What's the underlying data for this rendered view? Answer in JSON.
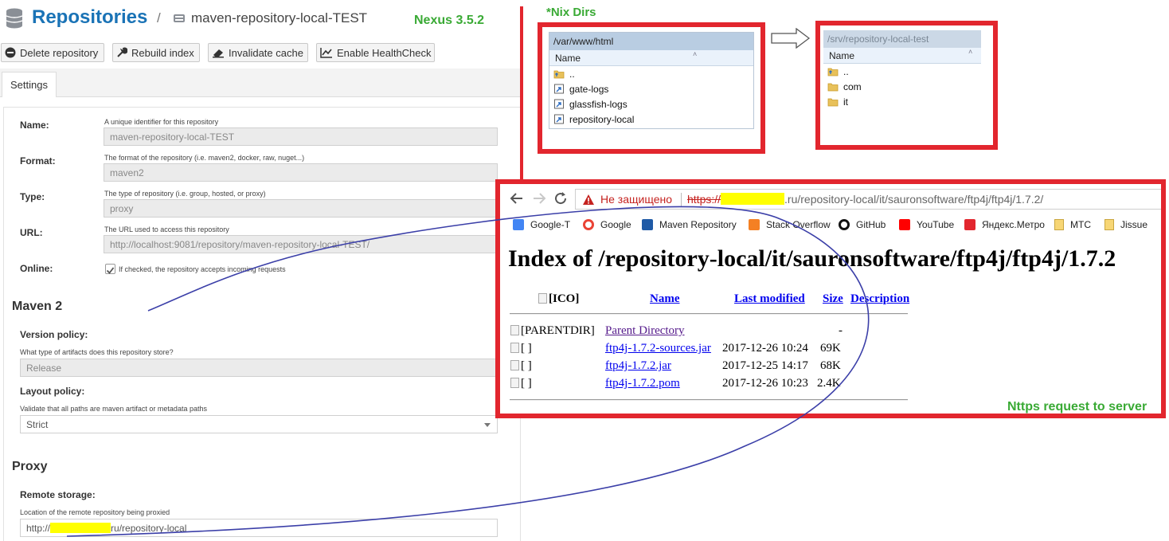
{
  "nexus": {
    "title": "Repositories",
    "separator": "/",
    "repo_name": "maven-repository-local-TEST",
    "version_label": "Nexus 3.5.2",
    "toolbar": [
      {
        "label": "Delete repository",
        "icon": "delete-icon"
      },
      {
        "label": "Rebuild index",
        "icon": "wrench-icon"
      },
      {
        "label": "Invalidate cache",
        "icon": "eraser-icon"
      },
      {
        "label": "Enable HealthCheck",
        "icon": "chart-icon"
      }
    ],
    "tab": "Settings",
    "fields": {
      "name": {
        "label": "Name:",
        "help": "A unique identifier for this repository",
        "value": "maven-repository-local-TEST"
      },
      "format": {
        "label": "Format:",
        "help": "The format of the repository (i.e. maven2, docker, raw, nuget...)",
        "value": "maven2"
      },
      "type": {
        "label": "Type:",
        "help": "The type of repository (i.e. group, hosted, or proxy)",
        "value": "proxy"
      },
      "url": {
        "label": "URL:",
        "help": "The URL used to access this repository",
        "value": "http://localhost:9081/repository/maven-repository-local-TEST/"
      },
      "online": {
        "label": "Online:",
        "help": "If checked, the repository accepts incoming requests",
        "checked": true
      }
    },
    "maven2": {
      "heading": "Maven 2",
      "version_policy": {
        "label": "Version policy:",
        "help": "What type of artifacts does this repository store?",
        "value": "Release"
      },
      "layout_policy": {
        "label": "Layout policy:",
        "help": "Validate that all paths are maven artifact or metadata paths",
        "value": "Strict"
      }
    },
    "proxy": {
      "heading": "Proxy",
      "remote_storage": {
        "label": "Remote storage:",
        "help": "Location of the remote repository being proxied",
        "value_prefix": "http://",
        "value_suffix": "ru/repository-local"
      }
    }
  },
  "nix": {
    "label": "*Nix Dirs",
    "left": {
      "path": "/var/www/html",
      "column": "Name",
      "items": [
        {
          "name": "..",
          "icon": "up-folder-icon"
        },
        {
          "name": "gate-logs",
          "icon": "shortcut-icon"
        },
        {
          "name": "glassfish-logs",
          "icon": "shortcut-icon"
        },
        {
          "name": "repository-local",
          "icon": "shortcut-icon"
        }
      ]
    },
    "right": {
      "path": "/srv/repository-local-test",
      "column": "Name",
      "items": [
        {
          "name": "..",
          "icon": "up-folder-icon"
        },
        {
          "name": "com",
          "icon": "folder-icon"
        },
        {
          "name": "it",
          "icon": "folder-icon"
        }
      ]
    }
  },
  "browser": {
    "not_secure": "Не защищено",
    "url_scheme": "https://",
    "url_rest": ".ru/repository-local/it/sauronsoftware/ftp4j/ftp4j/1.7.2/",
    "bookmarks": [
      {
        "label": "Google-T",
        "icon": "google-translate-icon",
        "color": "#4285f4"
      },
      {
        "label": "Google",
        "icon": "google-icon",
        "color": "#ea4335"
      },
      {
        "label": "Maven Repository",
        "icon": "maven-icon",
        "color": "#1f5aa6"
      },
      {
        "label": "Stack Overflow",
        "icon": "stackoverflow-icon",
        "color": "#f48024"
      },
      {
        "label": "GitHub",
        "icon": "github-icon",
        "color": "#111111"
      },
      {
        "label": "YouTube",
        "icon": "youtube-icon",
        "color": "#ff0000"
      },
      {
        "label": "Яндекс.Метро",
        "icon": "metro-icon",
        "color": "#e2262e"
      },
      {
        "label": "МТС",
        "icon": "bookmark-folder-icon",
        "color": "#f7d675"
      },
      {
        "label": "Jissue",
        "icon": "bookmark-folder-icon",
        "color": "#f7d675"
      }
    ],
    "page": {
      "heading": "Index of /repository-local/it/sauronsoftware/ftp4j/ftp4j/1.7.2",
      "columns": {
        "icon": "[ICO]",
        "name": "Name",
        "modified": "Last modified",
        "size": "Size",
        "description": "Description"
      },
      "rows": [
        {
          "icon": "[PARENTDIR]",
          "name": "Parent Directory",
          "modified": "",
          "size": "-"
        },
        {
          "icon": "[ ]",
          "name": "ftp4j-1.7.2-sources.jar",
          "modified": "2017-12-26 10:24",
          "size": "69K"
        },
        {
          "icon": "[ ]",
          "name": "ftp4j-1.7.2.jar",
          "modified": "2017-12-25 14:17",
          "size": "68K"
        },
        {
          "icon": "[ ]",
          "name": "ftp4j-1.7.2.pom",
          "modified": "2017-12-26 10:23",
          "size": "2.4K"
        }
      ]
    },
    "request_label": "Nttps request to server"
  },
  "colors": {
    "nexus_blue": "#1a73b6",
    "annotation_green": "#3aaa35",
    "frame_red": "#e2262e",
    "curve_blue": "#3b3fa8"
  }
}
